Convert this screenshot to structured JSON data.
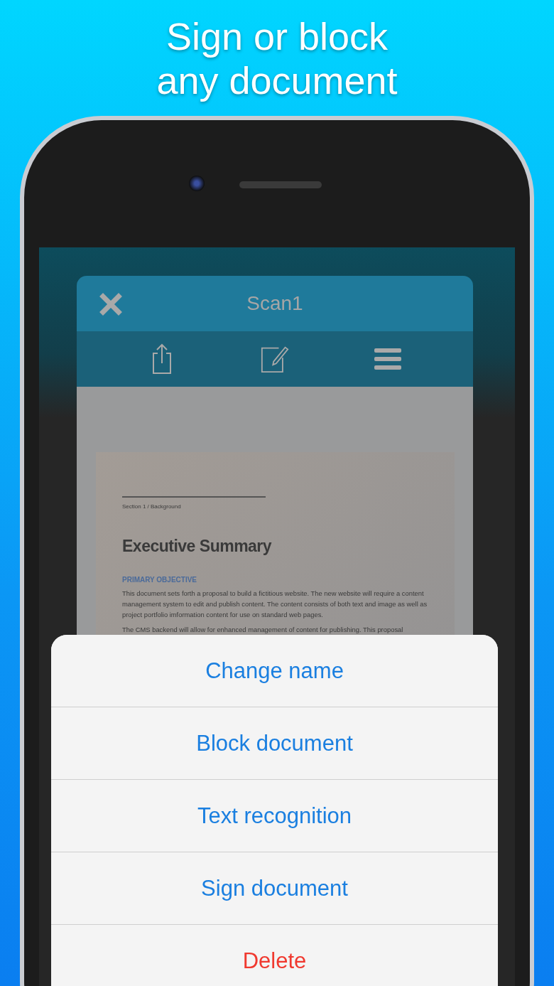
{
  "headline": [
    "Sign or block",
    "any document"
  ],
  "app": {
    "title": "Scan1"
  },
  "document": {
    "section": "Section 1 / Background",
    "heading": "Executive Summary",
    "subheading": "PRIMARY OBJECTIVE",
    "paragraphs": [
      "This document sets forth a proposal to build a fictitious website. The new website will require a content management system to edit and publish content. The content consists of both text and image as well as project portfolio imformation content for use on standard web pages.",
      "The CMS backend will allow for enhanced management of content for publishing. This proposal"
    ]
  },
  "action_sheet": [
    {
      "label": "Change name",
      "kind": "default"
    },
    {
      "label": "Block document",
      "kind": "default"
    },
    {
      "label": "Text recognition",
      "kind": "default"
    },
    {
      "label": "Sign document",
      "kind": "default"
    },
    {
      "label": "Delete",
      "kind": "destructive"
    }
  ]
}
